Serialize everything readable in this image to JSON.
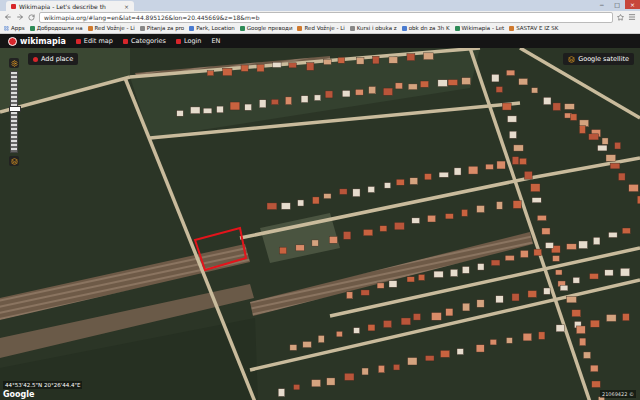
{
  "browser": {
    "tab_title": "Wikimapia - Let's describe th",
    "tab_close": "×",
    "window_controls": [
      "−",
      "□",
      "×"
    ],
    "url": "wikimapia.org/#lang=en&lat=44.895126&lon=20.445669&z=18&m=b",
    "bookmarks": [
      {
        "label": "Apps"
      },
      {
        "label": "Добродошли на"
      },
      {
        "label": "Red Vožnje - Li"
      },
      {
        "label": "Pitanja za pro"
      },
      {
        "label": "Park, Location"
      },
      {
        "label": "Google преводи"
      },
      {
        "label": "Red Vožnje - Li"
      },
      {
        "label": "Kursi i obuka z"
      },
      {
        "label": "obk dn za 3h K"
      },
      {
        "label": "Wikimapia - Let"
      },
      {
        "label": "SASTAV E IZ SK"
      }
    ]
  },
  "toolbar": {
    "logo": "wikimapia",
    "menus": [
      {
        "label": "Edit map"
      },
      {
        "label": "Categories"
      },
      {
        "label": "Login"
      }
    ],
    "language": "EN"
  },
  "map": {
    "add_place": "Add place",
    "layer": "Google satellite",
    "zoom_level": 0.55,
    "selected_area": true,
    "coordinates": "44°53'42.5\"N 20°26'44.4\"E",
    "attribution": "Google",
    "scale_note": "21069422 ©"
  }
}
